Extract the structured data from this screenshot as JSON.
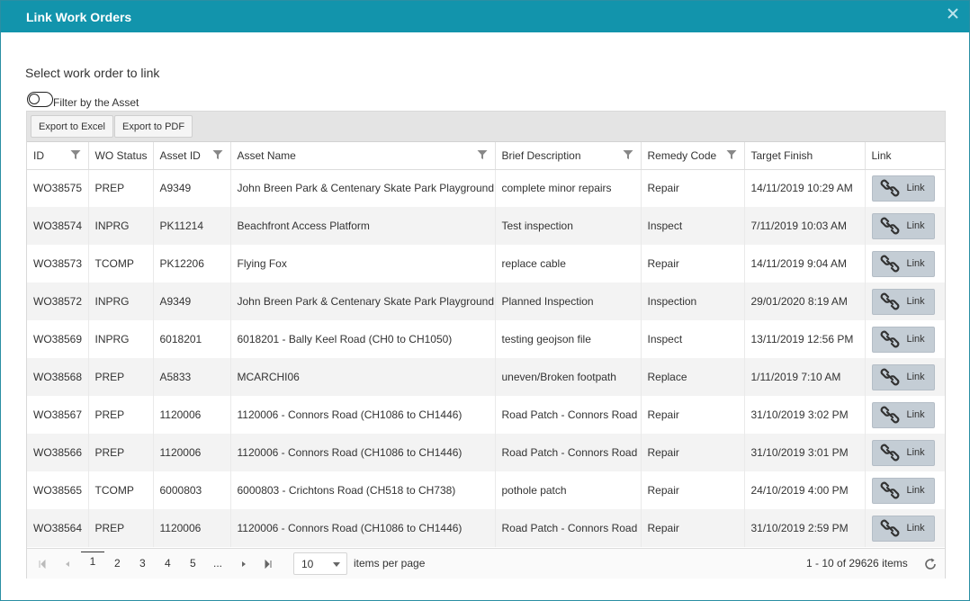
{
  "dialog": {
    "title": "Link Work Orders",
    "close_icon": "close-icon"
  },
  "section_title": "Select work order to link",
  "filter_toggle": {
    "label": "Filter by the Asset",
    "on": false
  },
  "toolbar": {
    "export_excel": "Export to Excel",
    "export_pdf": "Export to PDF"
  },
  "columns": [
    "ID",
    "WO Status",
    "Asset ID",
    "Asset Name",
    "Brief Description",
    "Remedy Code",
    "Target Finish",
    "Link"
  ],
  "rows": [
    {
      "id": "WO38575",
      "status": "PREP",
      "asset_id": "A9349",
      "asset_name": "John Breen Park & Centenary Skate Park Playground",
      "desc": "complete minor repairs",
      "remedy": "Repair",
      "finish": "14/11/2019 10:29 AM",
      "link": "Link"
    },
    {
      "id": "WO38574",
      "status": "INPRG",
      "asset_id": "PK11214",
      "asset_name": "Beachfront Access Platform",
      "desc": "Test inspection",
      "remedy": "Inspect",
      "finish": "7/11/2019 10:03 AM",
      "link": "Link"
    },
    {
      "id": "WO38573",
      "status": "TCOMP",
      "asset_id": "PK12206",
      "asset_name": "Flying Fox",
      "desc": "replace cable",
      "remedy": "Repair",
      "finish": "14/11/2019 9:04 AM",
      "link": "Link"
    },
    {
      "id": "WO38572",
      "status": "INPRG",
      "asset_id": "A9349",
      "asset_name": "John Breen Park & Centenary Skate Park Playground",
      "desc": "Planned Inspection",
      "remedy": "Inspection",
      "finish": "29/01/2020 8:19 AM",
      "link": "Link"
    },
    {
      "id": "WO38569",
      "status": "INPRG",
      "asset_id": "6018201",
      "asset_name": "6018201 - Bally Keel Road (CH0 to CH1050)",
      "desc": "testing geojson file",
      "remedy": "Inspect",
      "finish": "13/11/2019 12:56 PM",
      "link": "Link"
    },
    {
      "id": "WO38568",
      "status": "PREP",
      "asset_id": "A5833",
      "asset_name": "MCARCHI06",
      "desc": "uneven/Broken footpath",
      "remedy": "Replace",
      "finish": "1/11/2019 7:10 AM",
      "link": "Link"
    },
    {
      "id": "WO38567",
      "status": "PREP",
      "asset_id": "1120006",
      "asset_name": "1120006 - Connors Road (CH1086 to CH1446)",
      "desc": "Road Patch - Connors Road",
      "remedy": "Repair",
      "finish": "31/10/2019 3:02 PM",
      "link": "Link"
    },
    {
      "id": "WO38566",
      "status": "PREP",
      "asset_id": "1120006",
      "asset_name": "1120006 - Connors Road (CH1086 to CH1446)",
      "desc": "Road Patch - Connors Road",
      "remedy": "Repair",
      "finish": "31/10/2019 3:01 PM",
      "link": "Link"
    },
    {
      "id": "WO38565",
      "status": "TCOMP",
      "asset_id": "6000803",
      "asset_name": "6000803 - Crichtons Road (CH518 to CH738)",
      "desc": "pothole patch",
      "remedy": "Repair",
      "finish": "24/10/2019 4:00 PM",
      "link": "Link"
    },
    {
      "id": "WO38564",
      "status": "PREP",
      "asset_id": "1120006",
      "asset_name": "1120006 - Connors Road (CH1086 to CH1446)",
      "desc": "Road Patch - Connors Road",
      "remedy": "Repair",
      "finish": "31/10/2019 2:59 PM",
      "link": "Link"
    }
  ],
  "pager": {
    "pages": [
      "1",
      "2",
      "3",
      "4",
      "5",
      "..."
    ],
    "current_page": "1",
    "page_size": "10",
    "items_per_page_label": "items per page",
    "info": "1 - 10 of 29626 items"
  },
  "colors": {
    "titlebar": "#1294ac",
    "toolbar": "#e4e4e4",
    "link_button": "#c4cdd5"
  }
}
